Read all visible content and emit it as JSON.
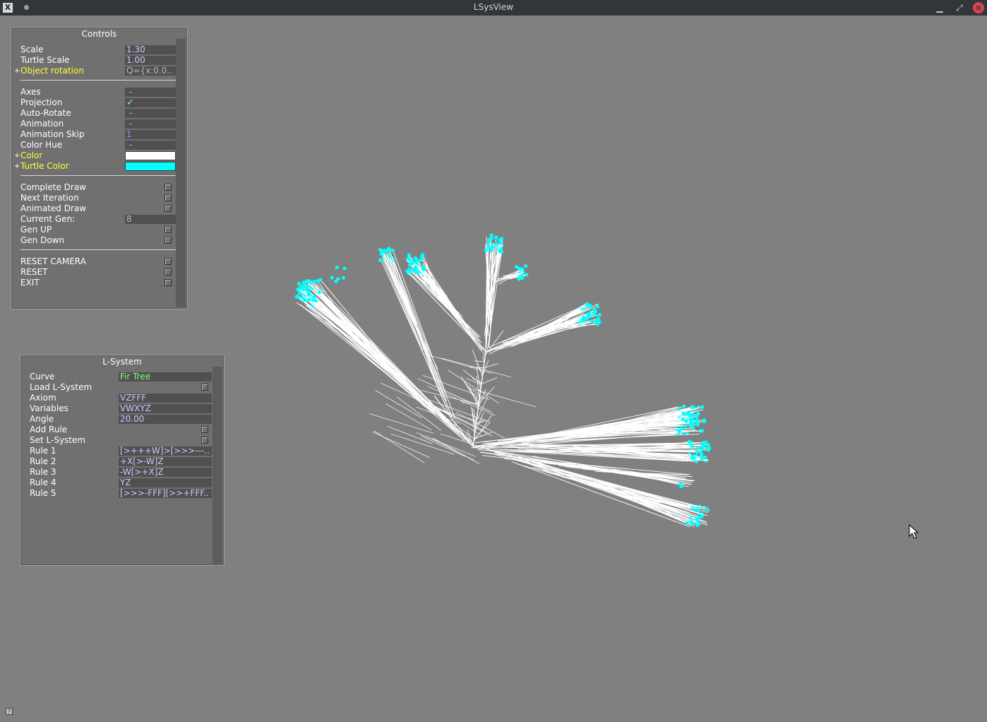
{
  "window": {
    "title": "LSysView",
    "app_icon": "X",
    "minimize_icon": "minimize-icon",
    "maximize_icon": "maximize-icon",
    "close_icon": "close-icon"
  },
  "controls": {
    "title": "Controls",
    "scale": {
      "label": "Scale",
      "value": "1.30"
    },
    "turtle_scale": {
      "label": "Turtle Scale",
      "value": "1.00"
    },
    "object_rotation": {
      "label": "Object rotation",
      "value": "Q={x:0.0.."
    },
    "axes": {
      "label": "Axes",
      "value": "-"
    },
    "projection": {
      "label": "Projection",
      "value": "✓"
    },
    "auto_rotate": {
      "label": "Auto-Rotate",
      "value": "-"
    },
    "animation": {
      "label": "Animation",
      "value": "-"
    },
    "animation_skip": {
      "label": "Animation Skip",
      "value": "1"
    },
    "color_hue": {
      "label": "Color Hue",
      "value": "-"
    },
    "color": {
      "label": "Color",
      "value": "#ffffff"
    },
    "turtle_color": {
      "label": "Turtle Color",
      "value": "#00ffff"
    },
    "complete_draw": {
      "label": "Complete Draw"
    },
    "next_iteration": {
      "label": "Next Iteration"
    },
    "animated_draw": {
      "label": "Animated Draw"
    },
    "current_gen": {
      "label": "Current Gen:",
      "value": "8"
    },
    "gen_up": {
      "label": "Gen UP"
    },
    "gen_down": {
      "label": "Gen Down"
    },
    "reset_camera": {
      "label": "RESET CAMERA"
    },
    "reset": {
      "label": "RESET"
    },
    "exit": {
      "label": "EXIT"
    }
  },
  "lsystem": {
    "title": "L-System",
    "curve": {
      "label": "Curve",
      "value": "Fir Tree"
    },
    "load": {
      "label": "Load L-System"
    },
    "axiom": {
      "label": "Axiom",
      "value": "VZFFF"
    },
    "variables": {
      "label": "Variables",
      "value": "VWXYZ"
    },
    "angle": {
      "label": "Angle",
      "value": "20.00"
    },
    "add_rule": {
      "label": "Add Rule"
    },
    "set_lsystem": {
      "label": "Set L-System"
    },
    "rules": [
      {
        "label": "Rule 1",
        "value": "[>+++W]>[>>>---.."
      },
      {
        "label": "Rule 2",
        "value": "+X[>-W]Z"
      },
      {
        "label": "Rule 3",
        "value": "-W[>+X]Z"
      },
      {
        "label": "Rule 4",
        "value": "YZ"
      },
      {
        "label": "Rule 5",
        "value": "[>>>-FFF][>>+FFF.."
      }
    ]
  },
  "colors": {
    "background": "#808080",
    "branch": "#ffffff",
    "leaf": "#00ffff",
    "label_highlight": "#ffff33"
  }
}
